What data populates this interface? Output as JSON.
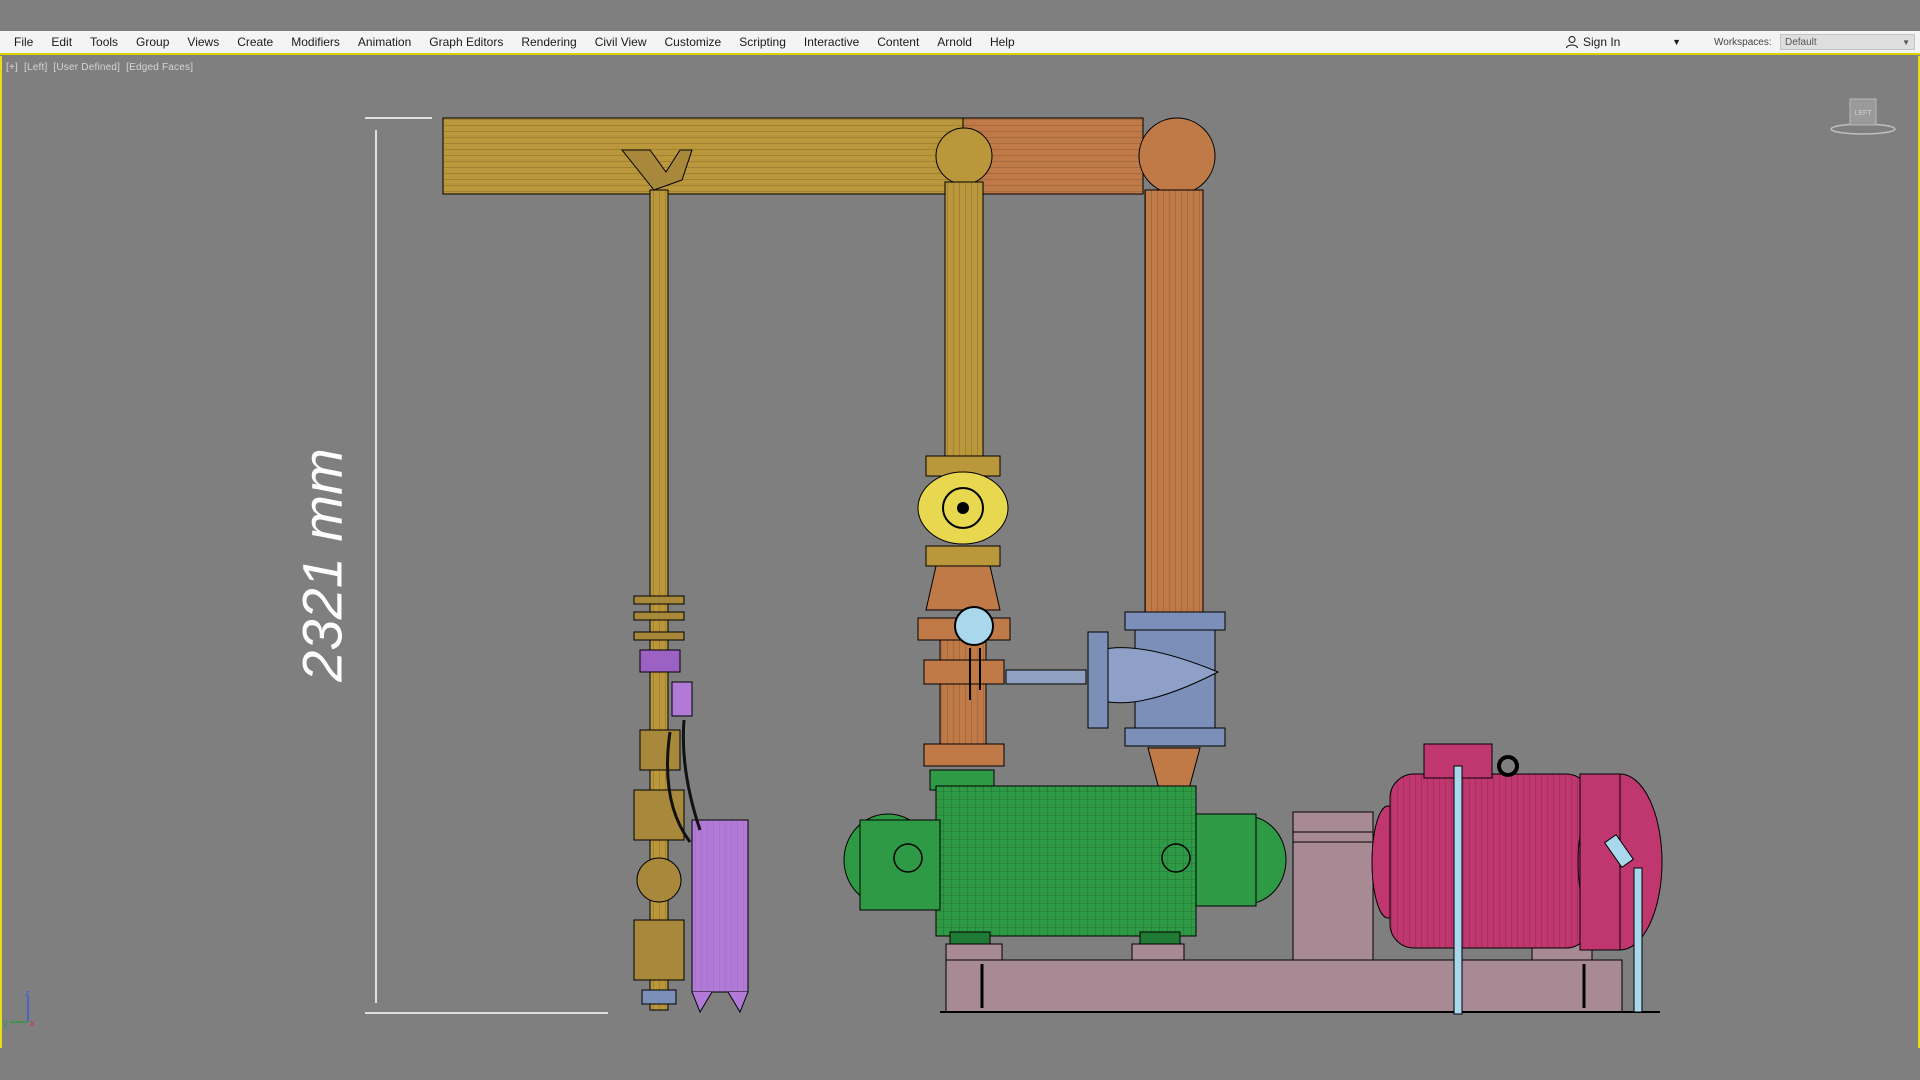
{
  "menu": {
    "items": [
      {
        "label": "File"
      },
      {
        "label": "Edit"
      },
      {
        "label": "Tools"
      },
      {
        "label": "Group"
      },
      {
        "label": "Views"
      },
      {
        "label": "Create"
      },
      {
        "label": "Modifiers"
      },
      {
        "label": "Animation"
      },
      {
        "label": "Graph Editors"
      },
      {
        "label": "Rendering"
      },
      {
        "label": "Civil View"
      },
      {
        "label": "Customize"
      },
      {
        "label": "Scripting"
      },
      {
        "label": "Interactive"
      },
      {
        "label": "Content"
      },
      {
        "label": "Arnold"
      },
      {
        "label": "Help"
      }
    ]
  },
  "account": {
    "signin_label": "Sign In"
  },
  "workspace": {
    "label": "Workspaces:",
    "value": "Default"
  },
  "viewport": {
    "labels": [
      "[+]",
      "[Left]",
      "[User Defined]",
      "[Edged Faces]"
    ],
    "viewcube_label": "LEFT",
    "dimension_text": "2321 mm",
    "axis_labels": {
      "x": "x",
      "y": "y",
      "z": "z"
    }
  },
  "colors": {
    "viewport_bg": "#7f7f7f",
    "active_border": "#e6de1a",
    "pipe_gold": "#b9973a",
    "pipe_orange": "#c07a48",
    "pump_green": "#2f9a45",
    "motor_magenta": "#c0376f",
    "valve_blue": "#7b8fb8",
    "exchanger_violet": "#b07ad6",
    "base_mauve": "#a88a95"
  }
}
